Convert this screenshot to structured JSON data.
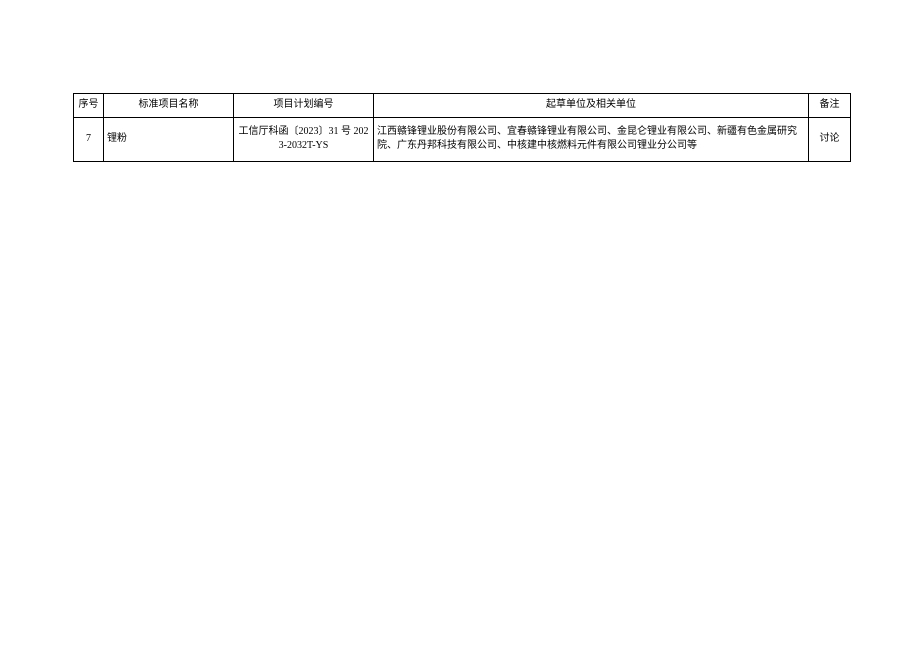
{
  "table": {
    "headers": {
      "seq": "序号",
      "name": "标准项目名称",
      "plan": "项目计划编号",
      "units": "起草单位及相关单位",
      "note": "备注"
    },
    "rows": [
      {
        "seq": "7",
        "name": "锂粉",
        "plan": "工信厅科函〔2023〕31 号 2023-2032T-YS",
        "units": "江西赣锋锂业股份有限公司、宜春赣锋锂业有限公司、金昆仑锂业有限公司、新疆有色金属研究院、广东丹邦科技有限公司、中核建中核燃料元件有限公司锂业分公司等",
        "note": "讨论"
      }
    ]
  }
}
